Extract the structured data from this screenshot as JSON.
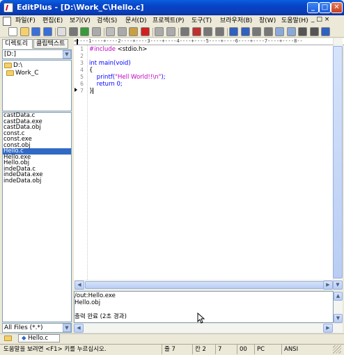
{
  "window": {
    "title": "EditPlus - [D:\\Work_C\\Hello.c]",
    "controls": {
      "minimize": "_",
      "maximize": "□",
      "close": "✕"
    },
    "title_gradient": "#0a5fe0",
    "close_color": "#c6401c"
  },
  "menu": {
    "items": [
      {
        "label": "파일(F)"
      },
      {
        "label": "편집(E)"
      },
      {
        "label": "보기(V)"
      },
      {
        "label": "검색(S)"
      },
      {
        "label": "문서(D)"
      },
      {
        "label": "프로젝트(P)"
      },
      {
        "label": "도구(T)"
      },
      {
        "label": "브라우저(B)"
      },
      {
        "label": "창(W)"
      },
      {
        "label": "도움말(H)"
      }
    ],
    "mdi_controls": "_ □ ×"
  },
  "toolbar": {
    "icons": [
      "new-file-icon",
      "open-icon",
      "save-icon",
      "save-all-icon",
      "print-preview-icon",
      "print-icon",
      "spellcheck-icon",
      "settings-icon",
      "cut-icon",
      "copy-icon",
      "paste-icon",
      "delete-icon",
      "undo-icon",
      "redo-icon",
      "find-icon",
      "replace-icon",
      "find-in-files-icon",
      "goto-icon",
      "font-icon",
      "word-wrap-icon",
      "column-icon",
      "ruler-icon",
      "tile-icon",
      "cascade-icon",
      "full-screen-icon",
      "close-window-icon",
      "help-icon"
    ]
  },
  "left_panel": {
    "tabs": [
      {
        "label": "디렉토리"
      },
      {
        "label": "클립텍스트"
      }
    ],
    "drive": "[D:]",
    "tree": [
      {
        "label": "D:\\"
      },
      {
        "label": "Work_C"
      }
    ],
    "files": [
      "castData.c",
      "castData.exe",
      "castData.obj",
      "const.c",
      "const.exe",
      "const.obj",
      "Hello.c",
      "Hello.exe",
      "Hello.obj",
      "indeData.c",
      "indeData.exe",
      "indeData.obj"
    ],
    "selected_file": "Hello.c",
    "filter": "All Files (*.*)"
  },
  "editor": {
    "ruler": "+----1----+----2----+----3----+----4----+----5----+----6----+----7----+----8--",
    "lines": [
      {
        "num": "1",
        "parts": [
          {
            "text": "#include ",
            "color": "#c000c0"
          },
          {
            "text": "<stdio.h>",
            "color": "#000000"
          }
        ]
      },
      {
        "num": "2",
        "parts": []
      },
      {
        "num": "3",
        "parts": [
          {
            "text": "int main(void)",
            "color": "#0000ff"
          }
        ]
      },
      {
        "num": "4",
        "parts": [
          {
            "text": "{",
            "color": "#000000"
          }
        ]
      },
      {
        "num": "5",
        "parts": [
          {
            "text": "    printf(",
            "color": "#0000ff"
          },
          {
            "text": "\"Hell World!!\\n\"",
            "color": "#c000c0"
          },
          {
            "text": ");",
            "color": "#0000ff"
          }
        ]
      },
      {
        "num": "6",
        "parts": [
          {
            "text": "    return 0;",
            "color": "#0000ff"
          }
        ]
      },
      {
        "num": "7",
        "parts": [
          {
            "text": "}",
            "color": "#000000"
          }
        ]
      }
    ]
  },
  "output": {
    "lines": [
      "/out:Hello.exe",
      "Hello.obj",
      "",
      "출력 완료 (2초 경과)"
    ]
  },
  "document_tab": {
    "label": "Hello.c"
  },
  "status": {
    "help": "도움말을 보려면 <F1> 키를 누르십시오.",
    "line": "줄 7",
    "col": "칸 2",
    "lines_total": "7",
    "hex": "00",
    "format": "PC",
    "encoding": "ANSI"
  },
  "colors": {
    "selection": "#316ac5",
    "keyword": "#0000ff",
    "preprocessor": "#c000c0"
  }
}
